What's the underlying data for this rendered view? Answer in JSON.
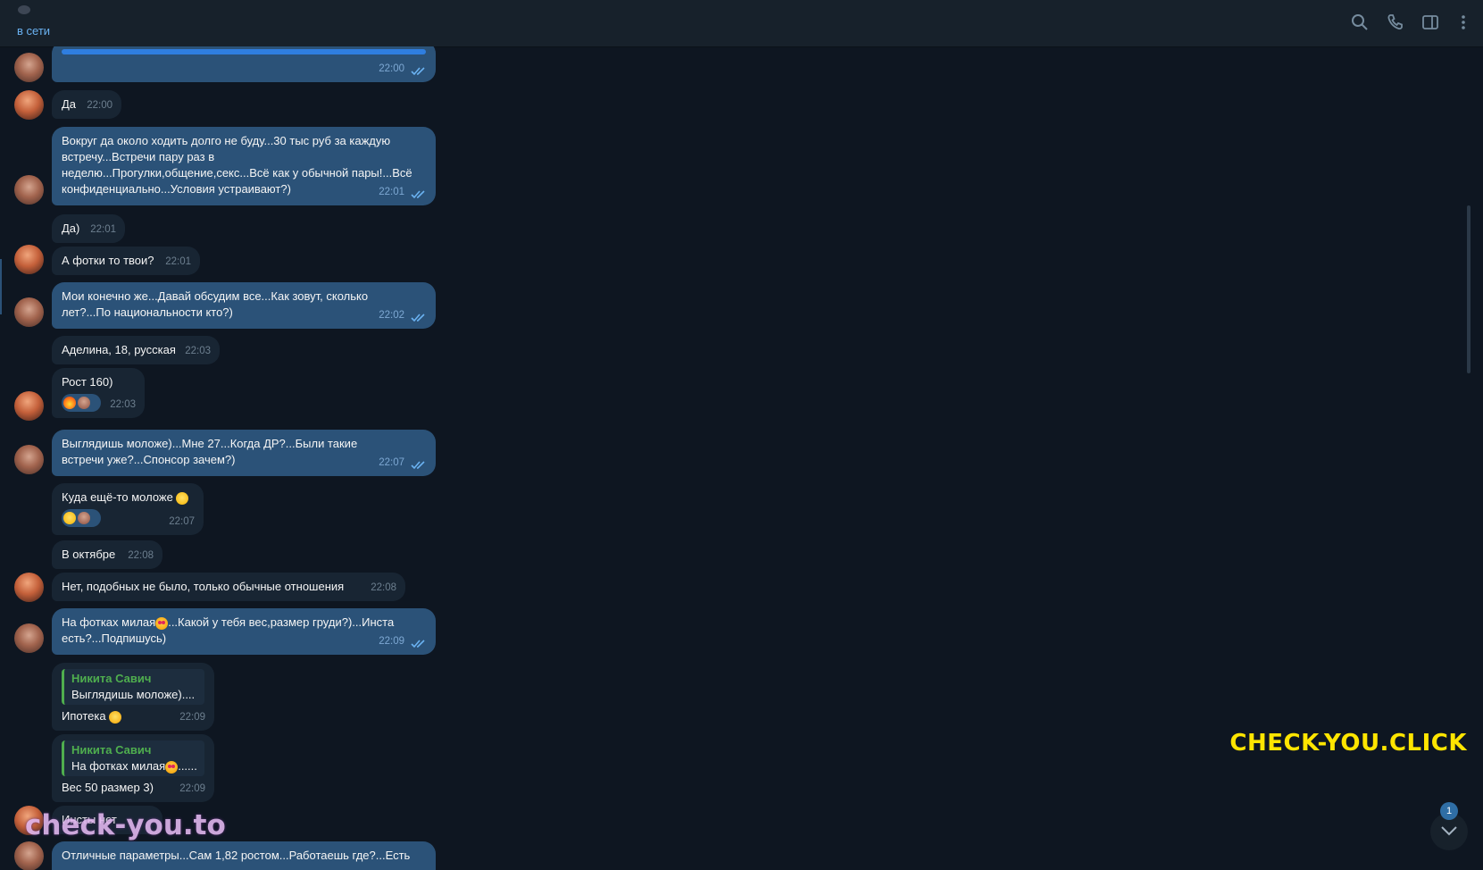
{
  "header": {
    "status": "в сети",
    "icons": [
      "search-icon",
      "phone-icon",
      "sidebar-toggle-icon",
      "more-icon"
    ]
  },
  "messages": [
    {
      "dir": "out",
      "time": "22:00",
      "text": ""
    },
    {
      "dir": "in",
      "time": "22:00",
      "text": "Да"
    },
    {
      "dir": "out",
      "time": "22:01",
      "text": "Вокруг да около ходить долго не буду...30 тыс руб за каждую встречу...Встречи пару раз в неделю...Прогулки,общение,секс...Всё как у обычной пары!...Всё конфиденциально...Условия устраивают?)"
    },
    {
      "dir": "in",
      "time": "22:01",
      "text": "Да)"
    },
    {
      "dir": "in",
      "time": "22:01",
      "text": "А фотки то твои?"
    },
    {
      "dir": "out",
      "time": "22:02",
      "text": "Мои конечно же...Давай обсудим все...Как зовут, сколько лет?...По национальности кто?)"
    },
    {
      "dir": "in",
      "time": "22:03",
      "text": "Аделина, 18, русская"
    },
    {
      "dir": "in",
      "time": "22:03",
      "text": "Рост 160)",
      "reaction": "fire"
    },
    {
      "dir": "out",
      "time": "22:07",
      "text": "Выглядишь моложе)...Мне 27...Когда ДР?...Были такие встречи уже?...Спонсор зачем?)"
    },
    {
      "dir": "in",
      "time": "22:07",
      "text": "Куда ещё-то моложе",
      "reaction": "grin"
    },
    {
      "dir": "in",
      "time": "22:08",
      "text": "В октябре"
    },
    {
      "dir": "in",
      "time": "22:08",
      "text": "Нет, подобных не было, только обычные отношения"
    },
    {
      "dir": "out",
      "time": "22:09",
      "text": "На фотках милая",
      "text2": "...Какой у тебя вес,размер груди?)...Инста есть?...Подпишусь)"
    },
    {
      "dir": "in",
      "time": "22:09",
      "reply_name": "Никита Савич",
      "reply_text": "Выглядишь моложе)....",
      "text": "Ипотека"
    },
    {
      "dir": "in",
      "time": "22:09",
      "reply_name": "Никита Савич",
      "reply_text": "На фотках милая",
      "reply_text2": "......",
      "text": "Вес 50 размер 3)"
    },
    {
      "dir": "in",
      "time": "",
      "text": "Инсты нет"
    },
    {
      "dir": "out",
      "time": "",
      "text": "Отличные параметры...Сам 1,82 ростом...Работаешь где?...Есть"
    }
  ],
  "watermarks": {
    "top": "CHECK-YOU.CLICK",
    "bottom": "check-you.to"
  },
  "scroll_button": {
    "unread": "1"
  },
  "colors": {
    "bg": "#0e1621",
    "out_bubble": "#2b5278",
    "in_bubble": "#182533",
    "accent": "#6ab2f2",
    "reply_name": "#4fae4e"
  }
}
